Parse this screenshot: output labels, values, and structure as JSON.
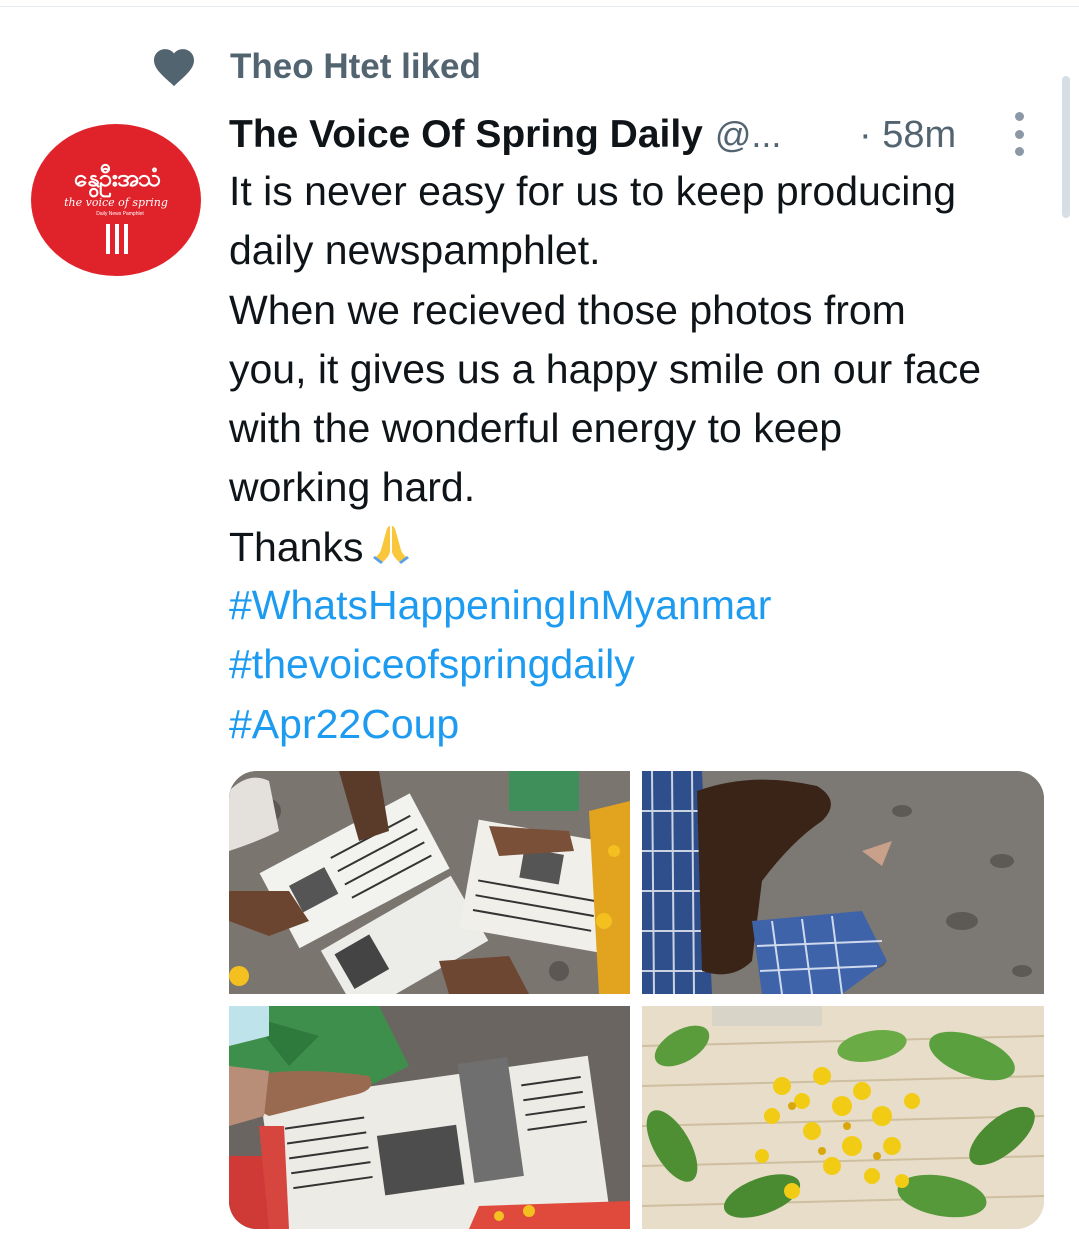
{
  "social_context": {
    "text": "Theo Htet liked"
  },
  "avatar": {
    "burmese_text": "နွေဦးအသံ",
    "english_text": "the voice of spring",
    "sub_text": "Daily News Pamphlet"
  },
  "tweet": {
    "display_name": "The Voice Of Spring Daily",
    "handle": "@...",
    "time": "· 58m",
    "text": "It is never easy for us to keep producing\ndaily newspamphlet.\nWhen we recieved those photos from\nyou, it gives us a happy smile on our face\nwith the wonderful energy to keep\nworking hard.\nThanks",
    "hashtags": [
      "#WhatsHappeningInMyanmar",
      "#thevoiceofspringdaily",
      "#Apr22Coup"
    ]
  },
  "colors": {
    "link": "#1d9bf0",
    "secondary_text": "#536471",
    "avatar_red": "#e0232b"
  },
  "icons": [
    "heart-icon",
    "more-icon",
    "folded-hands-emoji"
  ]
}
